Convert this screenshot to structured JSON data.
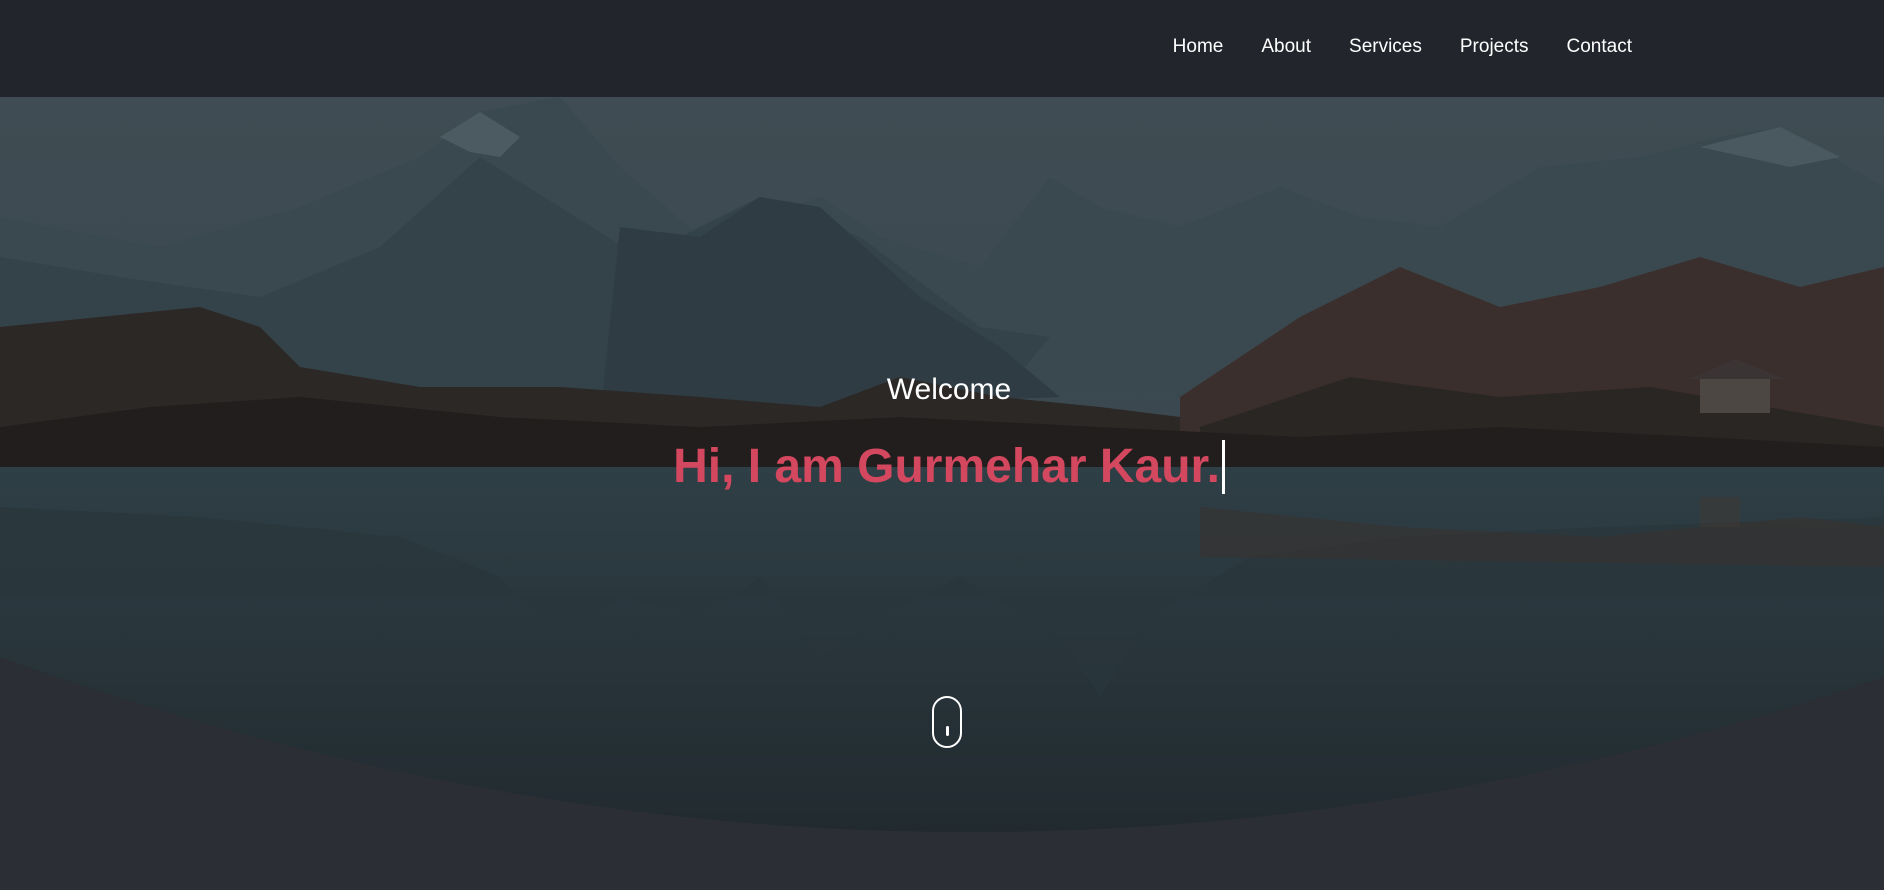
{
  "nav": {
    "items": [
      {
        "label": "Home"
      },
      {
        "label": "About"
      },
      {
        "label": "Services"
      },
      {
        "label": "Projects"
      },
      {
        "label": "Contact"
      }
    ]
  },
  "hero": {
    "welcome": "Welcome",
    "headline": "Hi, I am Gurmehar Kaur."
  },
  "icons": {
    "scroll": "mouse-scroll-icon"
  },
  "colors": {
    "navbar_bg": "#22262c",
    "headline_accent": "#d3485f",
    "page_bg": "#2b2f35"
  }
}
